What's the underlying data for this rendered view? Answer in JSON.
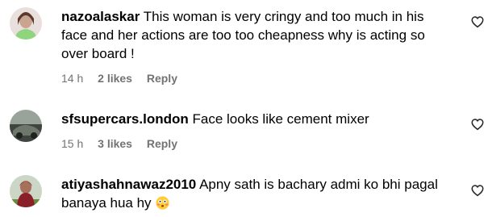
{
  "comments": [
    {
      "username": "nazoalaskar",
      "text": "This woman is very cringy and too much in his face and her actions are too too cheapness why is acting so over board !",
      "time": "14 h",
      "likes": "2 likes",
      "reply": "Reply",
      "avatar_color": "#c9b6b0"
    },
    {
      "username": "sfsupercars.london",
      "text": "Face looks like cement mixer",
      "time": "15 h",
      "likes": "3 likes",
      "reply": "Reply",
      "avatar_color": "#5a5f56"
    },
    {
      "username": "atiyashahnawaz2010",
      "text": "Apny sath is bachary admi ko bhi pagal banaya hua hy",
      "emoji": "flushed-face",
      "avatar_color": "#8a1f2a"
    }
  ],
  "icons": {
    "like": "heart-outline-icon"
  }
}
